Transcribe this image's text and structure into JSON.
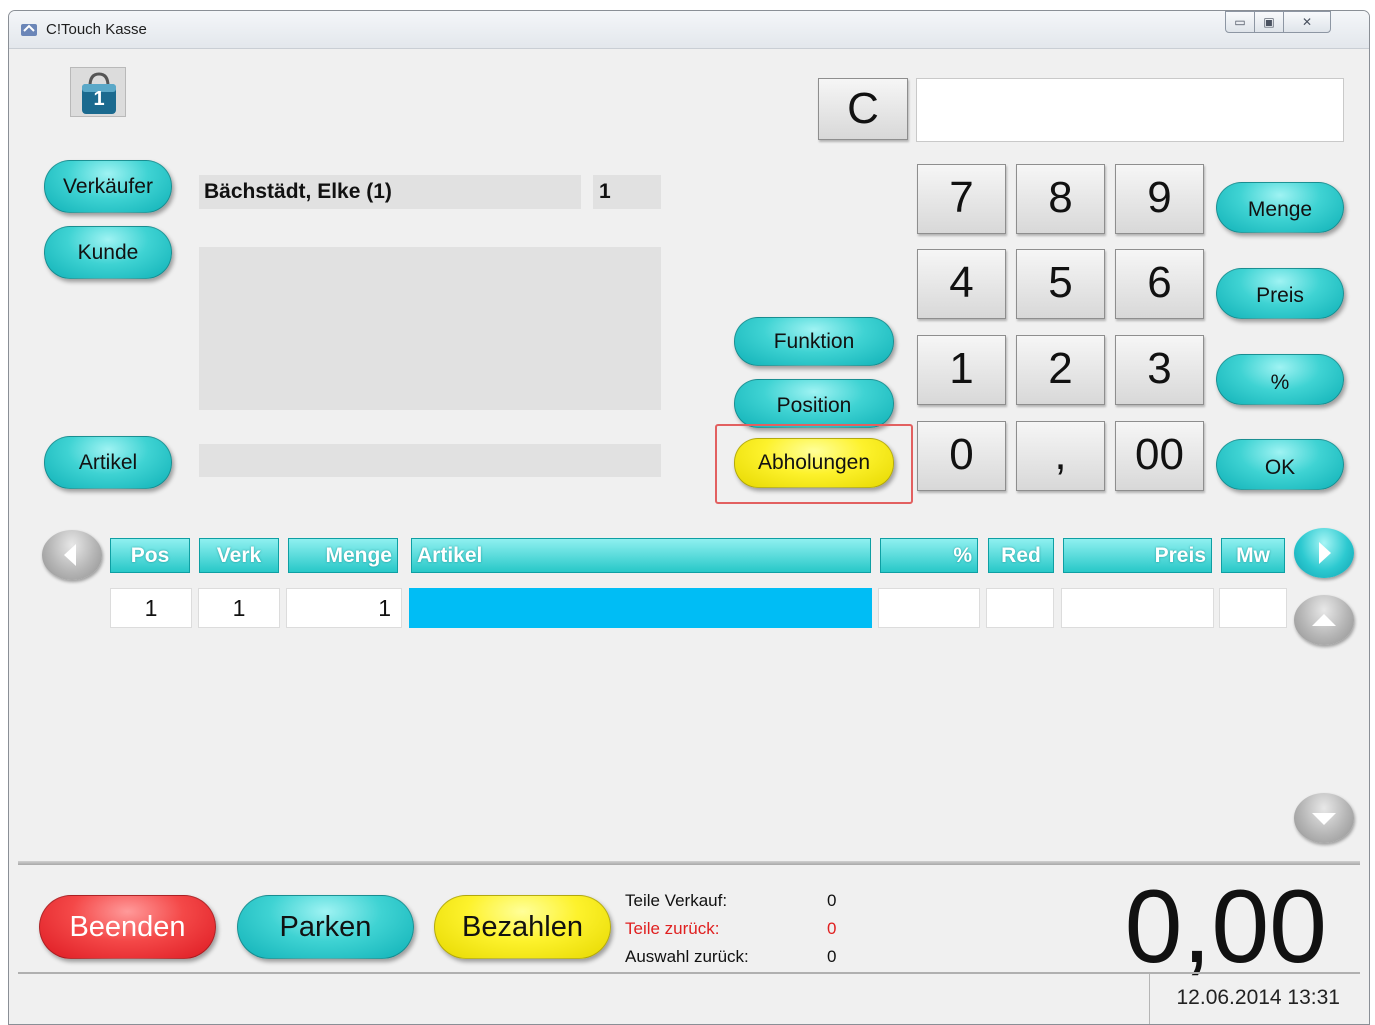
{
  "window": {
    "title": "C!Touch Kasse",
    "controls": {
      "minimize": "▭",
      "maximize": "▣",
      "close": "✕"
    }
  },
  "basket": {
    "badge": "1"
  },
  "keypad": {
    "clear": "C",
    "display_value": "",
    "keys": [
      "7",
      "8",
      "9",
      "4",
      "5",
      "6",
      "1",
      "2",
      "3",
      "0",
      ",",
      "00"
    ],
    "side_buttons": [
      "Menge",
      "Preis",
      "%",
      "OK"
    ]
  },
  "left_buttons": {
    "verkaeufer": "Verkäufer",
    "kunde": "Kunde",
    "artikel": "Artikel"
  },
  "seller": {
    "name": "Bächstädt, Elke (1)",
    "number": "1"
  },
  "middle_buttons": {
    "funktion": "Funktion",
    "position": "Position",
    "abholungen": "Abholungen"
  },
  "table": {
    "columns": [
      "Pos",
      "Verk",
      "Menge",
      "Artikel",
      "%",
      "Red",
      "Preis",
      "Mw"
    ],
    "rows": [
      {
        "pos": "1",
        "verk": "1",
        "menge": "1",
        "artikel": "",
        "pct": "",
        "red": "",
        "preis": "",
        "mw": ""
      }
    ]
  },
  "bottom": {
    "beenden": "Beenden",
    "parken": "Parken",
    "bezahlen": "Bezahlen",
    "stats": [
      {
        "label": "Teile Verkauf:",
        "value": "0"
      },
      {
        "label": "Teile zurück:",
        "value": "0"
      },
      {
        "label": "Auswahl zurück:",
        "value": "0"
      }
    ],
    "total": "0,00",
    "datetime": "12.06.2014 13:31"
  },
  "colors": {
    "teal": "#2cc9d0",
    "yellow": "#fdf22c",
    "red": "#f44848",
    "selection": "#00bdf5",
    "warning_text": "#e02020",
    "highlight_border": "#e26060"
  },
  "icons": {
    "basket": "shopping-bag-icon",
    "prev": "arrow-left-icon",
    "next": "arrow-right-icon",
    "up": "arrow-up-icon",
    "down": "arrow-down-icon"
  }
}
